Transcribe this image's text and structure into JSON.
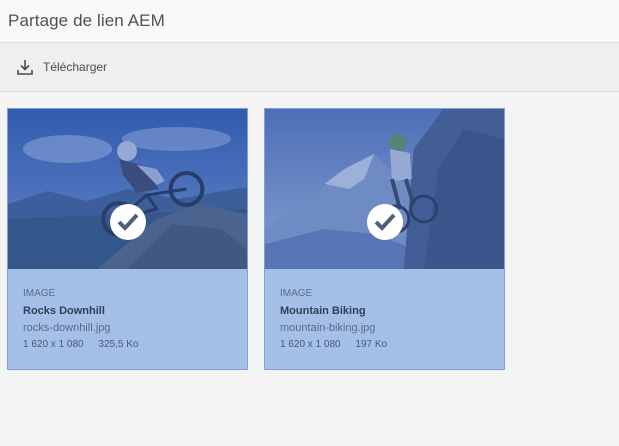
{
  "header": {
    "title": "Partage de lien AEM"
  },
  "toolbar": {
    "download_label": "Télécharger",
    "download_icon": "download-icon"
  },
  "assets": [
    {
      "type": "IMAGE",
      "title": "Rocks Downhill",
      "filename": "rocks-downhill.jpg",
      "dimensions": "1 620 x 1 080",
      "size": "325,5 Ko",
      "selected": true
    },
    {
      "type": "IMAGE",
      "title": "Mountain Biking",
      "filename": "mountain-biking.jpg",
      "dimensions": "1 620 x 1 080",
      "size": "197 Ko",
      "selected": true
    }
  ],
  "colors": {
    "selection_overlay": "#3a5faf",
    "card_fill": "#a4bfe8",
    "card_border": "#7e9fd8"
  }
}
